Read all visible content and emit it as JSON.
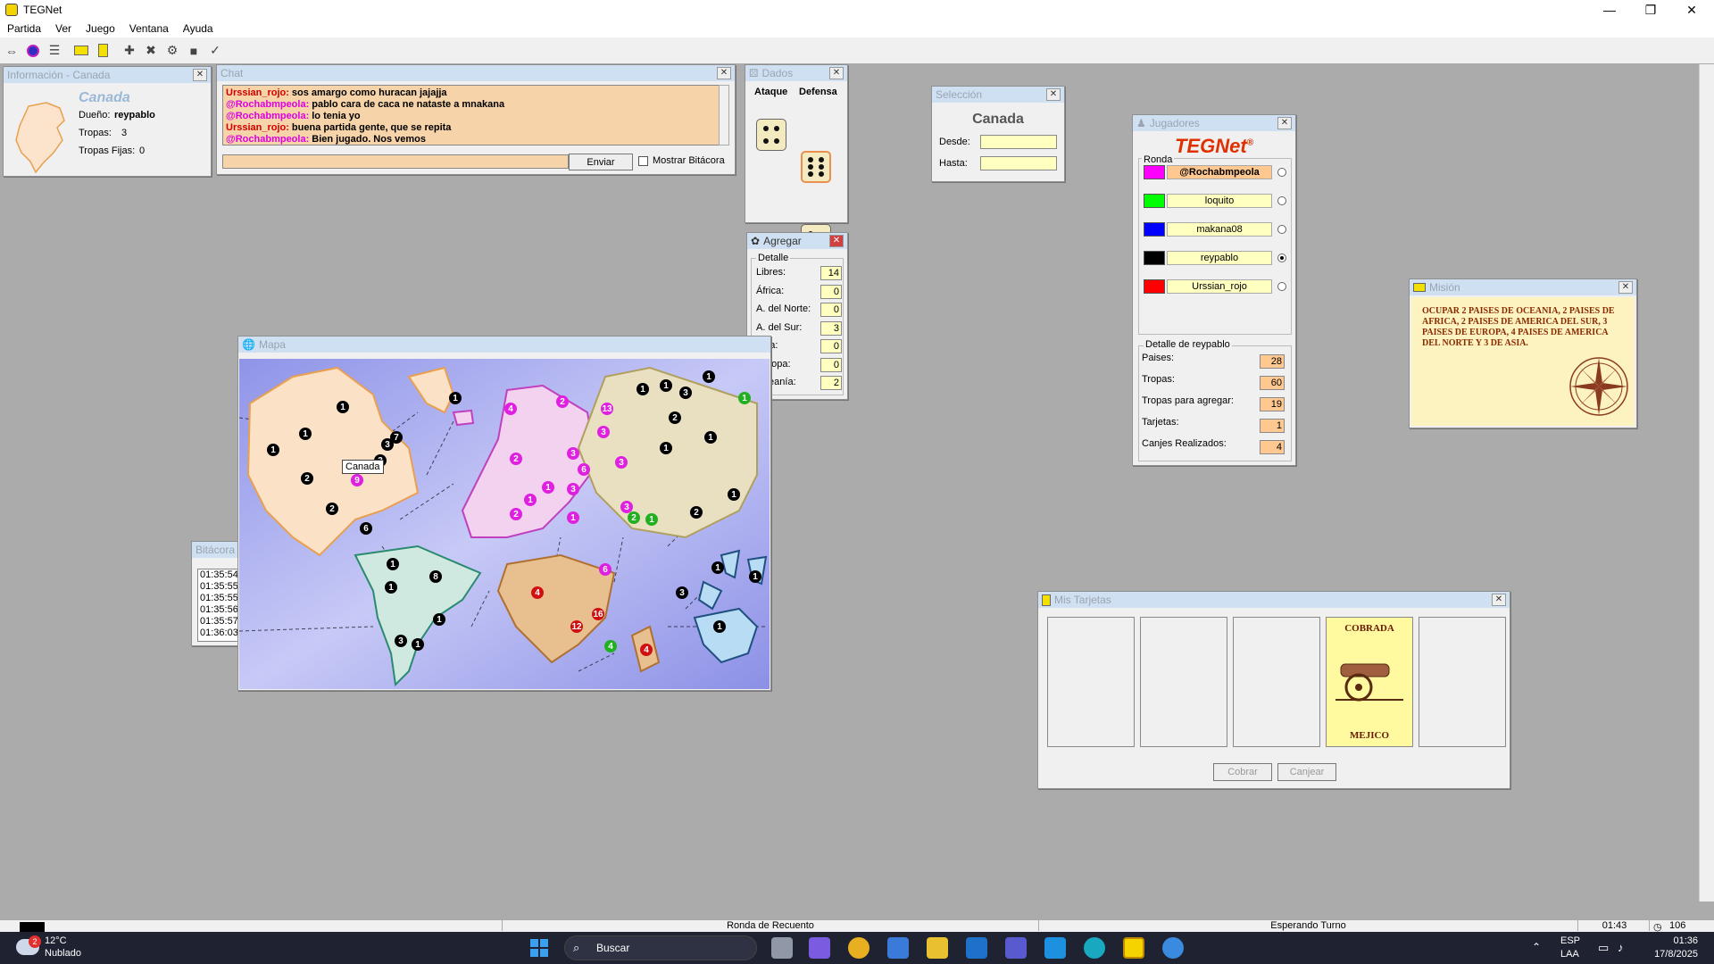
{
  "app": {
    "title": "TEGNet"
  },
  "window_controls": {
    "minimize": "—",
    "maximize": "❐",
    "close": "✕"
  },
  "menu": [
    "Partida",
    "Ver",
    "Juego",
    "Ventana",
    "Ayuda"
  ],
  "info": {
    "title": "Información - Canada",
    "country": "Canada",
    "owner_label": "Dueño:",
    "owner": "reypablo",
    "troops_label": "Tropas:",
    "troops": "3",
    "fixed_label": "Tropas Fijas:",
    "fixed": "0"
  },
  "chat": {
    "title": "Chat",
    "messages": [
      {
        "user": "Urssian_rojo:",
        "text": "sos amargo como huracan jajajja",
        "color": "#d00000"
      },
      {
        "user": "@Rochabmpeola:",
        "text": "pablo cara de caca ne nataste a mnakana",
        "color": "#e000e0"
      },
      {
        "user": "@Rochabmpeola:",
        "text": "lo tenia yo",
        "color": "#e000e0"
      },
      {
        "user": "Urssian_rojo:",
        "text": "buena partida gente, que se repita",
        "color": "#d00000"
      },
      {
        "user": "@Rochabmpeola:",
        "text": "Bien jugado. Nos vemos",
        "color": "#e000e0"
      }
    ],
    "send": "Enviar",
    "show_log": "Mostrar Bitácora"
  },
  "dice": {
    "title": "Dados",
    "attack": "Ataque",
    "defense": "Defensa"
  },
  "add": {
    "title": "Agregar",
    "group": "Detalle",
    "rows": [
      {
        "label": "Libres:",
        "value": "14"
      },
      {
        "label": "África:",
        "value": "0"
      },
      {
        "label": "A. del Norte:",
        "value": "0"
      },
      {
        "label": "A. del Sur:",
        "value": "3"
      },
      {
        "label": "Asia:",
        "value": "0"
      },
      {
        "label": "Europa:",
        "value": "0"
      },
      {
        "label": "Oceanía:",
        "value": "2"
      }
    ]
  },
  "selection": {
    "title": "Selección",
    "country": "Canada",
    "from": "Desde:",
    "to": "Hasta:"
  },
  "players": {
    "title": "Jugadores",
    "logo": "TEGNet",
    "logo_mark": "®",
    "round": "Ronda",
    "list": [
      {
        "name": "@Rochabmpeola",
        "color": "#ff00ff",
        "selected": false,
        "current": true
      },
      {
        "name": "loquito",
        "color": "#00ff00",
        "selected": false,
        "current": false
      },
      {
        "name": "makana08",
        "color": "#0000ff",
        "selected": false,
        "current": false
      },
      {
        "name": "reypablo",
        "color": "#000000",
        "selected": true,
        "current": false
      },
      {
        "name": "Urssian_rojo",
        "color": "#ff0000",
        "selected": false,
        "current": false
      }
    ],
    "detail_title": "Detalle de reypablo",
    "detail": [
      {
        "label": "Paises:",
        "value": "28"
      },
      {
        "label": "Tropas:",
        "value": "60"
      },
      {
        "label": "Tropas para agregar:",
        "value": "19"
      },
      {
        "label": "Tarjetas:",
        "value": "1"
      },
      {
        "label": "Canjes Realizados:",
        "value": "4"
      }
    ]
  },
  "mission": {
    "title": "Misión",
    "text": "OCUPAR 2 PAISES DE OCEANIA, 2 PAISES DE AFRICA, 2 PAISES DE AMERICA DEL SUR, 3 PAISES DE EUROPA, 4 PAISES DE AMERICA DEL NORTE Y 3 DE ASIA."
  },
  "map": {
    "title": "Mapa",
    "tooltip": "Canada"
  },
  "log": {
    "title": "Bitácora",
    "times": [
      "01:35:54",
      "01:35:55",
      "01:35:55",
      "01:35:56",
      "01:35:57",
      "01:36:03"
    ]
  },
  "cards": {
    "title": "Mis Tarjetas",
    "card_status": "COBRADA",
    "card_country": "MEJICO",
    "collect": "Cobrar",
    "exchange": "Canjear"
  },
  "status": {
    "round": "Ronda de Recuento",
    "state": "Esperando Turno",
    "time": "01:43",
    "count": "106"
  },
  "taskbar": {
    "temp": "12°C",
    "weather": "Nublado",
    "badge": "2",
    "search": "Buscar",
    "lang1": "ESP",
    "lang2": "LAA",
    "clock": "01:36",
    "date": "17/8/2025"
  }
}
